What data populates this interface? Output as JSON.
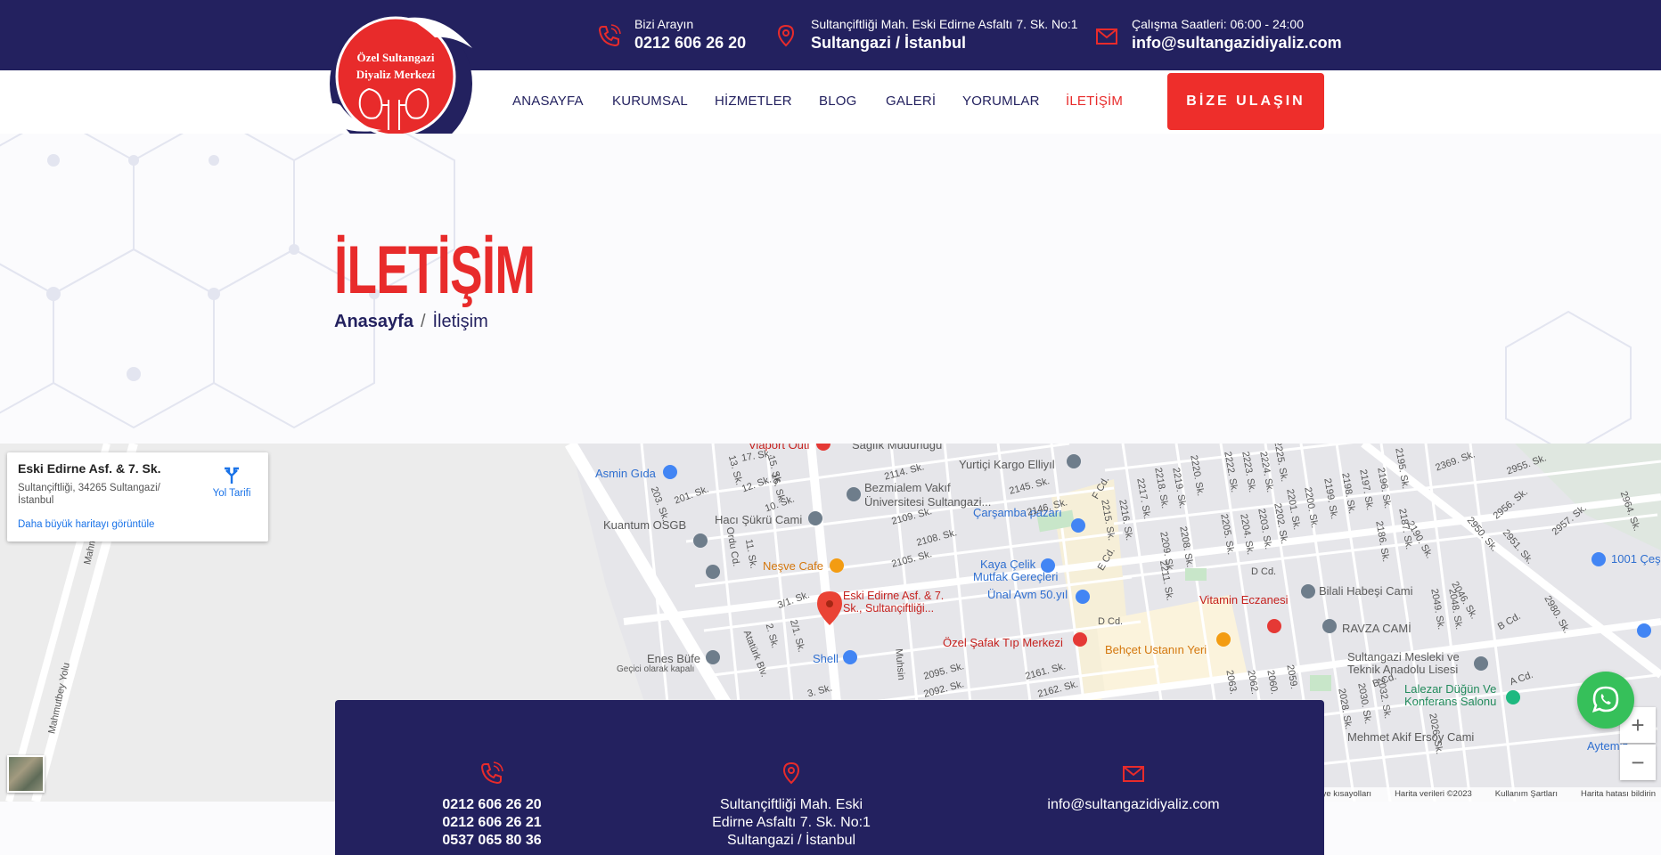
{
  "topbar": {
    "phone_label": "Bizi Arayın",
    "phone_value": "0212 606 26 20",
    "address_label": "Sultançiftliği Mah. Eski Edirne Asfaltı 7. Sk. No:1",
    "address_value": "Sultangazi / İstanbul",
    "hours_label": "Çalışma Saatleri: 06:00 - 24:00",
    "email_value": "info@sultangazidiyaliz.com"
  },
  "logo": {
    "line1": "Özel Sultangazi",
    "line2": "Diyaliz Merkezi"
  },
  "nav": {
    "items": [
      {
        "label": "ANASAYFA"
      },
      {
        "label": "KURUMSAL"
      },
      {
        "label": "HİZMETLER"
      },
      {
        "label": "BLOG"
      },
      {
        "label": "GALERİ"
      },
      {
        "label": "YORUMLAR"
      },
      {
        "label": "İLETİŞİM",
        "active": true
      }
    ],
    "cta_label": "BİZE ULAŞIN"
  },
  "hero": {
    "title": "İLETİŞİM",
    "breadcrumb_home": "Anasayfa",
    "breadcrumb_sep": "/",
    "breadcrumb_current": "İletişim"
  },
  "map": {
    "card_title": "Eski Edirne Asf. & 7. Sk.",
    "card_address": "Sultançiftliği, 34265 Sultangazi/ İstanbul",
    "card_link": "Daha büyük haritayı görüntüle",
    "card_directions": "Yol Tarifi",
    "pin_label_1": "Eski Edirne Asf. & 7.",
    "pin_label_2": "Sk., Sultançiftliği...",
    "places": {
      "asmin": "Asmin Gıda",
      "kuantum": "Kuantum OSGB",
      "haci": "Hacı Şükrü Cami",
      "bezmi1": "Bezmialem Vakıf",
      "bezmi2": "Üniversitesi Sultangazi...",
      "yurtici": "Yurtiçi Kargo Elliyıl",
      "carsamba": "Çarşamba pazarı",
      "nesve": "Neşve Cafe",
      "kaya1": "Kaya Çelik",
      "kaya2": "Mutfak Gereçleri",
      "unal": "Ünal Avm 50.yıl",
      "safak": "Özel Şafak Tıp Merkezi",
      "behcet": "Behçet Ustanın Yeri",
      "vitamin": "Vitamin Eczanesi",
      "bilali": "Bilali Habeşi Cami",
      "ravza": "RAVZA CAMİ",
      "mesleki1": "Sultangazi Mesleki ve",
      "mesleki2": "Teknik Anadolu Lisesi",
      "lalezar1": "Lalezar Düğün Ve",
      "lalezar2": "Konferans Salonu",
      "enes": "Enes Büfe",
      "enes_sub": "Geçici olarak kapalı",
      "shell": "Shell",
      "akif": "Mehmet Akif Ersoy Cami",
      "aytemiz": "Aytemiz",
      "ces": "1001 Çeş",
      "viaport": "Viaport Outl",
      "saglik": "Sağlık Müdürlüğü"
    },
    "streets": {
      "mahmutbey1": "Mahmutbey Yolu",
      "mahmutbey2": "Mahmutbey Yolu",
      "ataturk": "Atatürk Blv.",
      "ordu": "Ordu Cd.",
      "dcd1": "D Cd.",
      "dcd2": "D Cd.",
      "ecd": "E Cd.",
      "fcd": "F Cd.",
      "acd": "A Cd.",
      "bcd1": "B Cd.",
      "bcd2": "B Cd.",
      "s2114": "2114. Sk.",
      "s2145": "2145. Sk.",
      "s2146": "2146. Sk.",
      "s2109": "2109. Sk.",
      "s2108": "2108. Sk.",
      "s2105": "2105. Sk.",
      "s2095": "2095. Sk.",
      "s2092": "2092. Sk.",
      "s2161": "2161. Sk.",
      "s2162": "2162. Sk.",
      "s2369": "2369. Sk.",
      "s2955": "2955. Sk.",
      "s2956": "2956. Sk.",
      "s2957": "2957. Sk.",
      "s2950": "2950. Sk.",
      "s2951": "2951. Sk.",
      "s2964": "2964. Sk.",
      "s2980": "2980. Sk.",
      "s201": "201. Sk.",
      "s203": "203. Sk.",
      "s12": "12. Sk.",
      "s10": "10. Sk.",
      "s13": "13. Sk.",
      "s15": "15. Sk.",
      "s16": "16. Sk.",
      "s17": "17. Sk.",
      "s11": "11. Sk.",
      "s31": "3/1. Sk.",
      "s2": "2. Sk.",
      "s21": "2/1. Sk.",
      "s3": "3. Sk.",
      "muhsin": "Muhsin",
      "s2215": "2215. Sk.",
      "s2216": "2216. Sk.",
      "s2217": "2217. Sk.",
      "s2218": "2218. Sk.",
      "s2219": "2219. Sk.",
      "s2220": "2220. Sk.",
      "s2209": "2209. Sk.",
      "s2208": "2208. Sk.",
      "s2211": "2211. Sk.",
      "s2222": "2222. Sk.",
      "s2223": "2223. Sk.",
      "s2224": "2224. Sk.",
      "s2225": "2225. Sk.",
      "s2205": "2205. Sk.",
      "s2204": "2204. Sk.",
      "s2203": "2203. Sk.",
      "s2202": "2202. Sk.",
      "s2201": "2201. Sk.",
      "s2200": "2200. Sk.",
      "s2199": "2199. Sk.",
      "s2198": "2198. Sk.",
      "s2197": "2197. Sk.",
      "s2196": "2196. Sk.",
      "s2195": "2195. Sk.",
      "s2187": "2187. Sk.",
      "s2186": "2186. Sk.",
      "s2190": "2190. Sk.",
      "s2049": "2049. Sk.",
      "s2048": "2048. Sk.",
      "s2046": "2046. Sk.",
      "s2063": "2063.",
      "s2062": "2062.",
      "s2060": "2060.",
      "s2059": "2059.",
      "s2028": "2028. Sk.",
      "s2030": "2030. Sk.",
      "s2032": "2032. Sk.",
      "s2026": "2026. Sk."
    },
    "attribution": {
      "kbd": "Klavye kısayolları",
      "data": "Harita verileri ©2023",
      "terms": "Kullanım Şartları",
      "report": "Harita hatası bildirin"
    },
    "zoom_in": "+",
    "zoom_out": "−"
  },
  "contact": {
    "phones": [
      "0212 606 26 20",
      "0212 606 26 21",
      "0537 065 80 36"
    ],
    "address_lines": [
      "Sultançiftliği Mah. Eski",
      "Edirne Asfaltı 7. Sk. No:1",
      "Sultangazi / İstanbul"
    ],
    "email": "info@sultangazidiyaliz.com"
  },
  "colors": {
    "navy": "#23215f",
    "red": "#e82b2b",
    "whatsapp": "#36c05a"
  }
}
